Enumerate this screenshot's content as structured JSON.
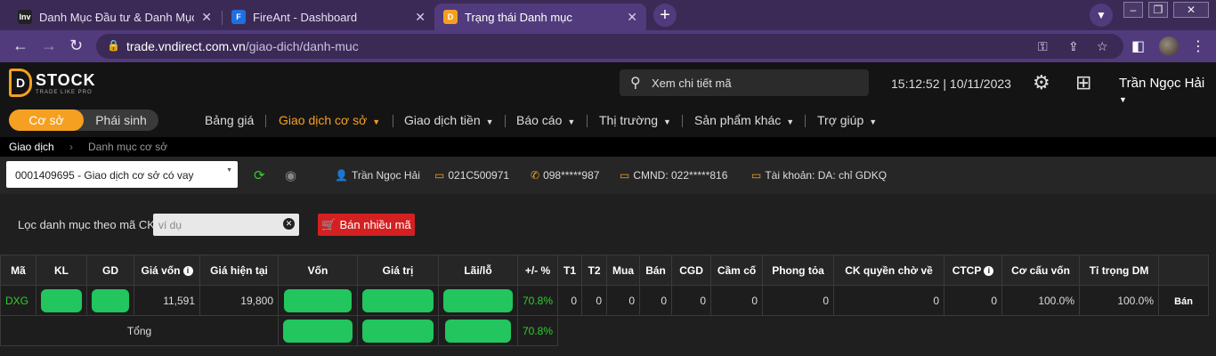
{
  "browser": {
    "tabs": [
      {
        "title": "Danh Mục Đầu tư & Danh Mục T",
        "favicon": "Inv"
      },
      {
        "title": "FireAnt - Dashboard",
        "favicon": "F"
      },
      {
        "title": "Trạng thái Danh mục",
        "favicon": "D"
      }
    ],
    "url_host": "trade.vndirect.com.vn",
    "url_path": "/giao-dich/danh-muc"
  },
  "app": {
    "logo_big": "STOCK",
    "logo_small": "TRADE LIKE PRO",
    "logo_letter": "D",
    "search_placeholder": "Xem chi tiết mã",
    "clock": "15:12:52 | 10/11/2023",
    "username": "Trần Ngọc Hải",
    "accent": "#f5a021"
  },
  "toggle": {
    "on": "Cơ sở",
    "off": "Phái sinh"
  },
  "menu": [
    {
      "label": "Bảng giá"
    },
    {
      "label": "Giao dịch cơ sở"
    },
    {
      "label": "Giao dịch tiền"
    },
    {
      "label": "Báo cáo"
    },
    {
      "label": "Thị trường"
    },
    {
      "label": "Sản phẩm khác"
    },
    {
      "label": "Trợ giúp"
    }
  ],
  "breadcrumb": {
    "root": "Giao dịch",
    "current": "Danh mục cơ sở"
  },
  "account": {
    "selected": "0001409695 - Giao dịch cơ sở có vay",
    "name": "Trần Ngọc Hải",
    "code": "021C500971",
    "phone": "098*****987",
    "id_card": "CMND: 022*****816",
    "account_type": "Tài khoản: DA: chỉ GDKQ"
  },
  "filter": {
    "label": "Lọc danh mục theo mã CK",
    "placeholder": "ví dụ",
    "sell_many": "Bán nhiều mã"
  },
  "table": {
    "headers": [
      "Mã",
      "KL",
      "GD",
      "Giá vốn",
      "Giá hiện tại",
      "Vốn",
      "Giá trị",
      "Lãi/lỗ",
      "+/- %",
      "T1",
      "T2",
      "Mua",
      "Bán",
      "CGD",
      "Cầm cố",
      "Phong tỏa",
      "CK quyền chờ về",
      "CTCP",
      "Cơ cấu vốn",
      "Tỉ trọng DM",
      ""
    ],
    "row": {
      "symbol": "DXG",
      "cost_price": "11,591",
      "current_price": "19,800",
      "pct": "70.8%",
      "t1": "0",
      "t2": "0",
      "buy": "0",
      "sell": "0",
      "cgd": "0",
      "pledge": "0",
      "blocked": "0",
      "rights": "0",
      "ctcp": "0",
      "capital_structure": "100.0%",
      "weight": "100.0%",
      "sell_btn": "Bán"
    },
    "total": {
      "label": "Tổng",
      "pct": "70.8%"
    }
  }
}
